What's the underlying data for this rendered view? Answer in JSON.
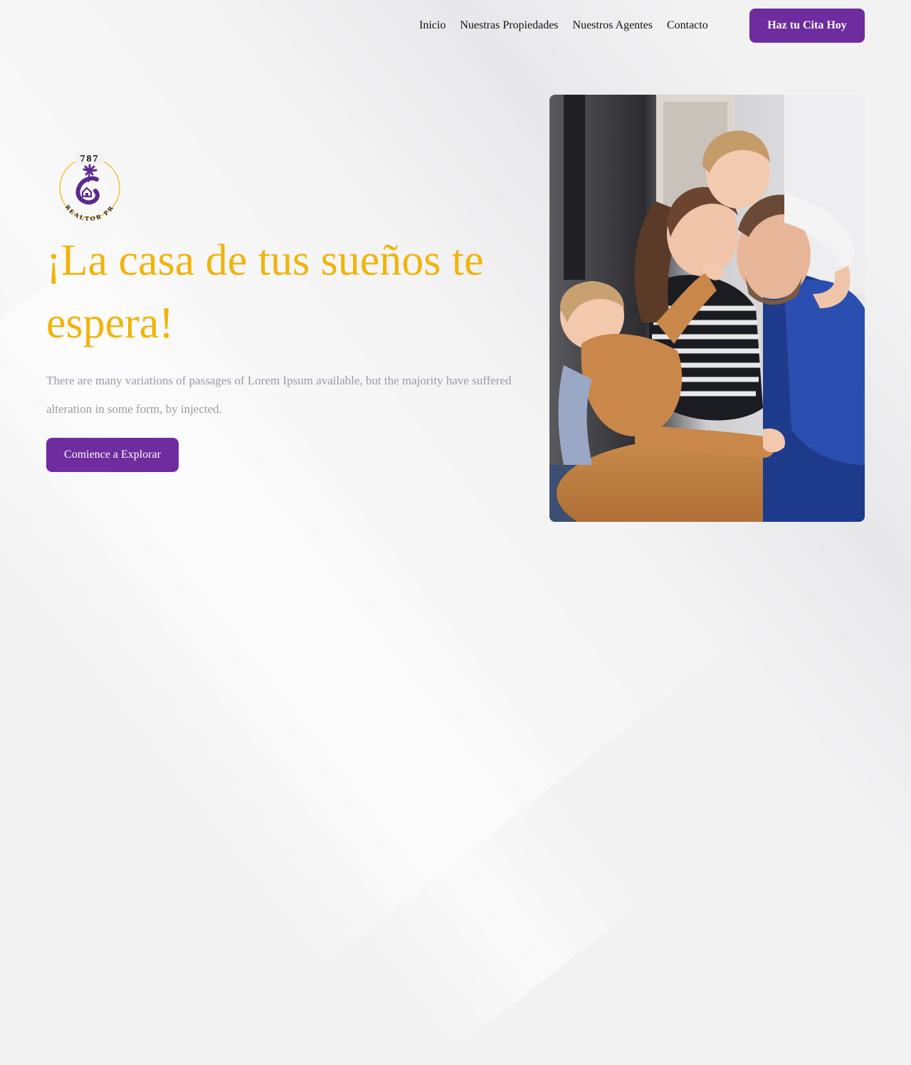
{
  "nav": {
    "links": [
      "Inicio",
      "Nuestras Propiedades",
      "Nuestros Agentes",
      "Contacto"
    ],
    "cta_label": "Haz tu Cita Hoy"
  },
  "logo": {
    "number": "787",
    "brand": "REALTOR PR"
  },
  "hero": {
    "title": "¡La casa de tus sueños te espera!",
    "description": "There are many variations of passages of Lorem Ipsum available, but the majority have suffered alteration in some form, by injected.",
    "cta_label": "Comience a Explorar"
  },
  "image": {
    "subject": "family-photo"
  },
  "colors": {
    "accent": "#6e2c9e",
    "title": "#f1b40c",
    "body_text": "#9a9aa6",
    "background": "#f2f2f3"
  }
}
